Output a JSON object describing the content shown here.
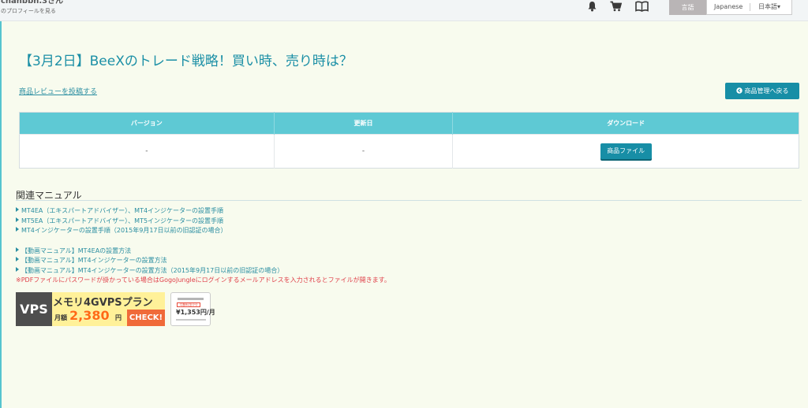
{
  "header": {
    "username": "chanbbn.3さん",
    "profile_link": "のプロフィールを見る",
    "icons": [
      "bell-icon",
      "cart-icon",
      "book-icon"
    ],
    "lang_label": "言語",
    "lang_japanese": "Japanese",
    "lang_select": "日本語▾"
  },
  "product": {
    "title": "【3月2日】BeeXのトレード戦略！買い時、売り時は？",
    "review_link": "商品レビューを投稿する",
    "back_button": "商品管理へ戻る"
  },
  "table": {
    "headers": [
      "バージョン",
      "更新日",
      "ダウンロード"
    ],
    "rows": [
      [
        "-",
        "-"
      ]
    ],
    "download_button": "商品ファイル"
  },
  "manuals": {
    "title": "関連マニュアル",
    "items": [
      "MT4EA（エキスパートアドバイザー）、MT4インジケーターの設置手順",
      "MT5EA（エキスパートアドバイザー）、MT5インジケーターの設置手順",
      "MT4インジケーターの設置手順（2015年9月17日以前の旧認証の場合）",
      "【動画マニュアル】MT4EAの設置方法",
      "【動画マニュアル】MT4インジケーターの設置方法",
      "【動画マニュアル】MT4インジケーターの設置方法（2015年9月17日以前の旧認証の場合）"
    ],
    "note": "※PDFファイルにパスワードが掛かっている場合はGogoJungleにログインするメールアドレスを入力されるとファイルが開きます。"
  },
  "banners": {
    "vps": {
      "logo": "VPS",
      "plan": "メモリ4GVPSプラン",
      "monthly": "月額",
      "price": "2,380",
      "yen": "円",
      "check": "CHECK!"
    },
    "promo": {
      "tag": "月額料金(円)",
      "price": "¥1,353円/月"
    }
  },
  "colors": {
    "accent": "#178ea6",
    "table_header": "#5ec9d4",
    "link": "#2a8ea1",
    "note": "#e0404a",
    "background": "#f8fbee"
  }
}
